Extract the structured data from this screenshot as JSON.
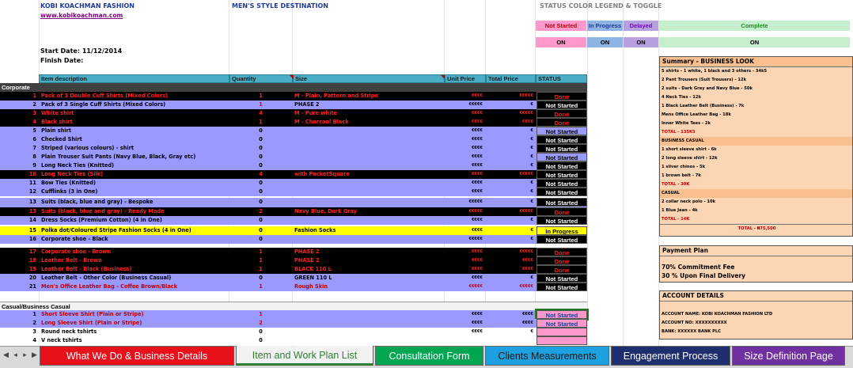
{
  "header": {
    "company": "KOBI KOACHMAN FASHION",
    "tagline": "MEN'S STYLE DESTINATION",
    "website": "www.kobikoachman.com",
    "start_date": "Start Date: 11/12/2014",
    "finish_date": "Finish Date:"
  },
  "legend": {
    "title": "STATUS COLOR LEGEND & TOGGLE",
    "items": [
      {
        "label": "Not Started",
        "toggle": "ON"
      },
      {
        "label": "In Progress",
        "toggle": "ON"
      },
      {
        "label": "Delayed",
        "toggle": "ON"
      },
      {
        "label": "Complete",
        "toggle": "ON"
      }
    ]
  },
  "table": {
    "headers": [
      "Item description",
      "Quantity",
      "Size",
      "Unit Price",
      "Total Price",
      "STATUS"
    ],
    "section_corporate": "Corporate",
    "section_casual": "Casual/Business Casual",
    "rows": [
      {
        "n": "1",
        "desc": "Pack of 3 Double Cuff Shirts (Mixed Colors)",
        "qty": "1",
        "size": "M - Plain, Pattern and Stripe",
        "up": "€€€€",
        "tp": "€€€€€",
        "status": "Done"
      },
      {
        "n": "2",
        "desc": "Pack of 3 Single Cuff Shirts (Mixed Colors)",
        "qty": "1",
        "size": "PHASE 2",
        "up": "€€€€€",
        "tp": "€",
        "status": "Not Started"
      },
      {
        "n": "3",
        "desc": "White shirt",
        "qty": "4",
        "size": "M - Pure white",
        "up": "€€€€",
        "tp": "€€€€€",
        "status": "Done"
      },
      {
        "n": "4",
        "desc": "Black shirt",
        "qty": "1",
        "size": "M - Charcoal Black",
        "up": "€€€€",
        "tp": "€€€€",
        "status": "Done"
      },
      {
        "n": "5",
        "desc": "Plain shirt",
        "qty": "0",
        "size": "",
        "up": "€€€€",
        "tp": "€",
        "status": "Not Started"
      },
      {
        "n": "6",
        "desc": "Checked Shirt",
        "qty": "0",
        "size": "",
        "up": "€€€€",
        "tp": "€",
        "status": "Not Started"
      },
      {
        "n": "7",
        "desc": "Striped (various colours) - shirt",
        "qty": "0",
        "size": "",
        "up": "€€€€",
        "tp": "€",
        "status": "Not Started"
      },
      {
        "n": "8",
        "desc": "Plain Trouser Suit Pants (Navy Blue, Black, Gray etc)",
        "qty": "0",
        "size": "",
        "up": "€€€€",
        "tp": "€",
        "status": "Not Started"
      },
      {
        "n": "9",
        "desc": "Long Neck Ties (Knitted)",
        "qty": "0",
        "size": "",
        "up": "€€€€",
        "tp": "€",
        "status": "Not Started"
      },
      {
        "n": "10",
        "desc": "Long Neck Ties (Silk)",
        "qty": "4",
        "size": "with PocketSquare",
        "up": "€€€€",
        "tp": "€€€€€",
        "status": "Not Started"
      },
      {
        "n": "11",
        "desc": "Bow Ties (Knitted)",
        "qty": "0",
        "size": "",
        "up": "€€€€",
        "tp": "€",
        "status": "Not Started"
      },
      {
        "n": "12",
        "desc": "Cufflinks (3 in One)",
        "qty": "0",
        "size": "",
        "up": "€€€€",
        "tp": "€",
        "status": "Not Started"
      },
      {
        "n": "13",
        "desc": "Suits (black, blue and gray) - Bespoke",
        "qty": "0",
        "size": "",
        "up": "€€€€€",
        "tp": "€",
        "status": "Not Started"
      },
      {
        "n": "13",
        "desc": "Suits (black, blue and gray) - Ready Made",
        "qty": "2",
        "size": "Navy Blue, Dark Gray",
        "up": "€€€€€",
        "tp": "€€€€€",
        "status": "Done"
      },
      {
        "n": "14",
        "desc": "Dress Socks (Premium Cotton) (4 in One)",
        "qty": "0",
        "size": "",
        "up": "€€€€",
        "tp": "€",
        "status": "Not Started"
      },
      {
        "n": "15",
        "desc": "Polka dot/Coloured Stripe Fashion Socks (4 in One)",
        "qty": "0",
        "size": "Fashion Socks",
        "up": "€€€€",
        "tp": "€",
        "status": "In Progress"
      },
      {
        "n": "16",
        "desc": "Corporate shoe - Black",
        "qty": "0",
        "size": "",
        "up": "€€€€€",
        "tp": "€",
        "status": "Not Started"
      },
      {
        "n": "17",
        "desc": "Corporate shoe - Brown",
        "qty": "1",
        "size": "PHASE 2",
        "up": "€€€€",
        "tp": "€€€€€",
        "status": "Done"
      },
      {
        "n": "18",
        "desc": "Leather Belt - Brown",
        "qty": "1",
        "size": "PHASE 2",
        "up": "€€€€",
        "tp": "€€€€",
        "status": "Done"
      },
      {
        "n": "19",
        "desc": "Leather Belt - Black (Business)",
        "qty": "1",
        "size": "BLACK 110 L",
        "up": "€€€€",
        "tp": "€€€€",
        "status": "Done"
      },
      {
        "n": "20",
        "desc": "Leather Belt - Other Color (Business Casual)",
        "qty": "0",
        "size": "GREEN 110 L",
        "up": "€€€€",
        "tp": "€",
        "status": "Not Started"
      },
      {
        "n": "21",
        "desc": "Men's Office Leather Bag - Coffee Brown/Black",
        "qty": "1",
        "size": "Rough Skin",
        "up": "€€€€€",
        "tp": "€€€€€",
        "status": "Not Started"
      }
    ],
    "casual_rows": [
      {
        "n": "1",
        "desc": "Short Sleeve Shirt (Plain or Stripe)",
        "qty": "1",
        "size": "",
        "up": "€€€€",
        "tp": "€€€€",
        "status": "Not Started"
      },
      {
        "n": "2",
        "desc": "Long Sleeve Shirt (Plain or Stripe)",
        "qty": "2",
        "size": "",
        "up": "€€€€",
        "tp": "€€€€",
        "status": "Not Started"
      },
      {
        "n": "3",
        "desc": "Round neck tshirts",
        "qty": "0",
        "size": "",
        "up": "€€€€",
        "tp": "€",
        "status": ""
      },
      {
        "n": "4",
        "desc": "V neck tshirts",
        "qty": "0",
        "size": "",
        "up": "",
        "tp": "",
        "status": ""
      }
    ]
  },
  "summary": {
    "title": "Summary - BUSINESS LOOK",
    "lines": [
      "5 shirts - 1 white, 1 black and 3 others - 34k5",
      "2 Pant Trousers (Suit Trousers) - 12k",
      "2 suits - Dark Grey and Navy Blue - 50k",
      "4 Neck Ties - 12k",
      "1 Black Leather Belt (Business) - 7k",
      "Mens Office Leather Bag - 18k",
      "Inner White Tees - 2k",
      "TOTAL - 135K5",
      "BUSINESS CASUAL",
      "1 short sleeve shirt - 6k",
      "2 long sleeve shirt - 12k",
      "1 silver chinos - 5k",
      "1 brown belt - 7k",
      "TOTAL - 30K",
      "CASUAL",
      "2 collar neck polo - 10k",
      "1 Blue Jean - 4k",
      "TOTAL - 14K"
    ],
    "grand_total": "TOTAL - ₦75,500"
  },
  "payment": {
    "title": "Payment Plan",
    "lines": [
      "70% Commitment Fee",
      "30 % Upon Final Delivery"
    ]
  },
  "account": {
    "title": "ACCOUNT DETAILS",
    "lines": [
      "ACCOUNT NAME: KOBI KOACHMAN FASHION LTD",
      "ACCOUNT NO: XXXXXXXXXX",
      "BANK: XXXXXX BANK PLC"
    ]
  },
  "tabs": [
    {
      "label": "What We Do & Business Details",
      "color": "#e8101a",
      "text": "#ffffff"
    },
    {
      "label": "Item and Work Plan List",
      "color": "#f2f2f2",
      "text": "#2e7d32"
    },
    {
      "label": "Consultation Form",
      "color": "#00a651",
      "text": "#ffffff"
    },
    {
      "label": "Clients Measurements",
      "color": "#1ca0e0",
      "text": "#1a1a1a"
    },
    {
      "label": "Engagement Process",
      "color": "#1f2e6e",
      "text": "#ffffff"
    },
    {
      "label": "Size Definition Page",
      "color": "#7030a0",
      "text": "#ffffff"
    }
  ],
  "colors": {
    "violet": "#9999ff",
    "header": "#4bacc6",
    "peach": "#fcd5b4"
  }
}
